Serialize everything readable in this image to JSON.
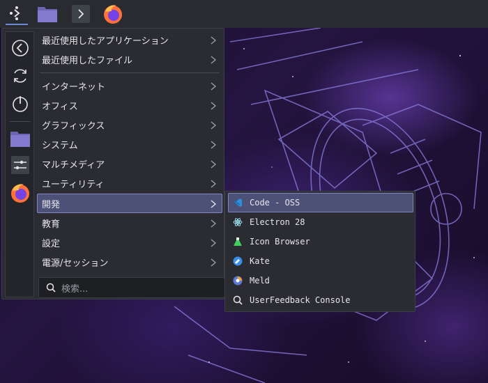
{
  "taskbar": {
    "items": [
      {
        "icon": "application-launcher-icon"
      },
      {
        "icon": "file-manager-icon"
      },
      {
        "icon": "terminal-icon"
      },
      {
        "icon": "firefox-icon"
      }
    ]
  },
  "sidebar": {
    "items": [
      {
        "icon": "back-icon"
      },
      {
        "icon": "refresh-icon"
      },
      {
        "icon": "power-icon"
      },
      {
        "icon": "folder-icon"
      },
      {
        "icon": "settings-sliders-icon"
      },
      {
        "icon": "firefox-icon"
      }
    ]
  },
  "menu": {
    "recent": [
      {
        "label": "最近使用したアプリケーション"
      },
      {
        "label": "最近使用したファイル"
      }
    ],
    "categories": [
      {
        "label": "インターネット"
      },
      {
        "label": "オフィス"
      },
      {
        "label": "グラフィックス"
      },
      {
        "label": "システム"
      },
      {
        "label": "マルチメディア"
      },
      {
        "label": "ユーティリティ"
      },
      {
        "label": "開発"
      },
      {
        "label": "教育"
      },
      {
        "label": "設定"
      },
      {
        "label": "電源/セッション"
      }
    ]
  },
  "search": {
    "placeholder": "検索..."
  },
  "submenu": {
    "items": [
      {
        "label": "Code - OSS",
        "icon": "vscode-icon"
      },
      {
        "label": "Electron 28",
        "icon": "electron-icon"
      },
      {
        "label": "Icon Browser",
        "icon": "flask-icon"
      },
      {
        "label": "Kate",
        "icon": "kate-icon"
      },
      {
        "label": "Meld",
        "icon": "meld-icon"
      },
      {
        "label": "UserFeedback Console",
        "icon": "search-icon"
      }
    ]
  },
  "colors": {
    "panel": "#2b2c32",
    "highlight": "#4d5178",
    "highlight_border": "#7e86c3",
    "accent": "#6d8cd8"
  }
}
